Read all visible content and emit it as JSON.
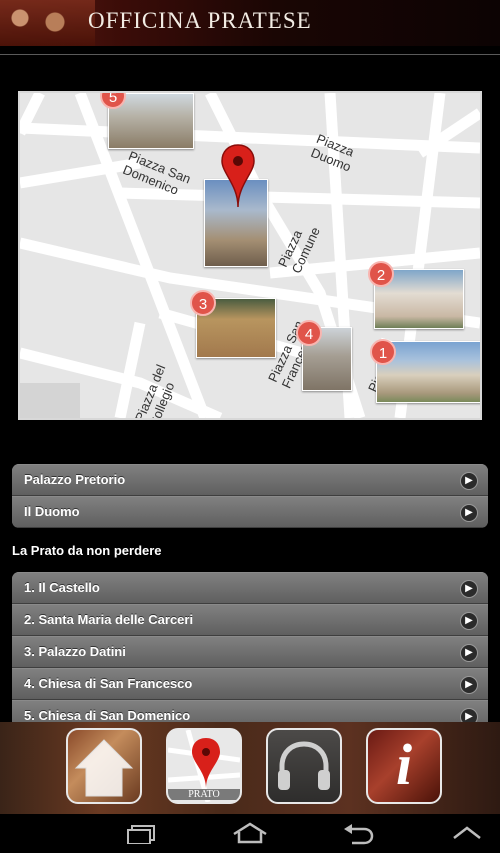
{
  "header": {
    "title": "OFFICINA PRATESE"
  },
  "map": {
    "streets": [
      "Piazza San Domenico",
      "Piazza Duomo",
      "Piazza Comune",
      "Piazza San Francesco",
      "Piazza S. Maria",
      "Piazza del Collegio"
    ],
    "markers": [
      "5",
      "2",
      "3",
      "4",
      "1"
    ],
    "colors": {
      "marker": "#e0544a",
      "pin": "#d8201a"
    }
  },
  "main_list": [
    {
      "label": "Palazzo Pretorio"
    },
    {
      "label": "Il Duomo"
    }
  ],
  "section": {
    "title": "La Prato da non perdere"
  },
  "must_see_list": [
    {
      "label": "1. Il Castello"
    },
    {
      "label": "2. Santa Maria delle Carceri"
    },
    {
      "label": "3. Palazzo Datini"
    },
    {
      "label": "4. Chiesa di San Francesco"
    },
    {
      "label": "5. Chiesa di San Domenico"
    }
  ],
  "toolbar": {
    "buttons": [
      {
        "icon": "home-icon"
      },
      {
        "icon": "map-pin-icon",
        "caption": "PRATO"
      },
      {
        "icon": "headphones-icon"
      },
      {
        "icon": "info-icon",
        "glyph": "i"
      }
    ]
  },
  "navbar": {
    "icons": [
      "recent-apps-icon",
      "home-icon",
      "back-icon",
      "up-icon"
    ]
  }
}
